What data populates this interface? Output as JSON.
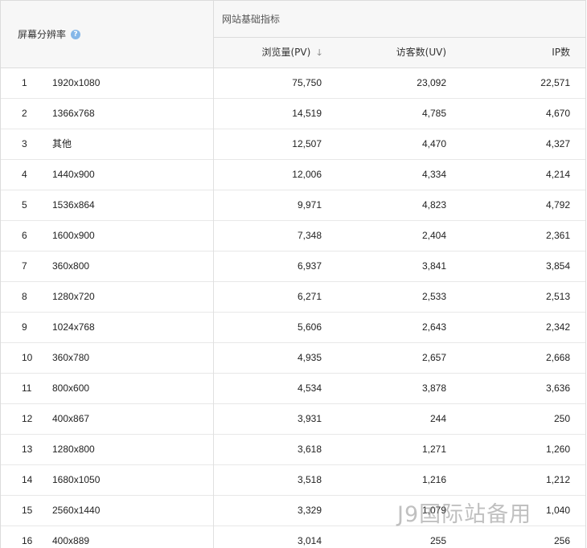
{
  "header": {
    "dimension_label": "屏幕分辨率",
    "help_icon": "?",
    "group_label": "网站基础指标",
    "columns": {
      "pv": "浏览量(PV)",
      "uv": "访客数(UV)",
      "ip": "IP数"
    },
    "sort_icon": "🡓"
  },
  "rows": [
    {
      "idx": "1",
      "res": "1920x1080",
      "pv": "75,750",
      "uv": "23,092",
      "ip": "22,571"
    },
    {
      "idx": "2",
      "res": "1366x768",
      "pv": "14,519",
      "uv": "4,785",
      "ip": "4,670"
    },
    {
      "idx": "3",
      "res": "其他",
      "pv": "12,507",
      "uv": "4,470",
      "ip": "4,327"
    },
    {
      "idx": "4",
      "res": "1440x900",
      "pv": "12,006",
      "uv": "4,334",
      "ip": "4,214"
    },
    {
      "idx": "5",
      "res": "1536x864",
      "pv": "9,971",
      "uv": "4,823",
      "ip": "4,792"
    },
    {
      "idx": "6",
      "res": "1600x900",
      "pv": "7,348",
      "uv": "2,404",
      "ip": "2,361"
    },
    {
      "idx": "7",
      "res": "360x800",
      "pv": "6,937",
      "uv": "3,841",
      "ip": "3,854"
    },
    {
      "idx": "8",
      "res": "1280x720",
      "pv": "6,271",
      "uv": "2,533",
      "ip": "2,513"
    },
    {
      "idx": "9",
      "res": "1024x768",
      "pv": "5,606",
      "uv": "2,643",
      "ip": "2,342"
    },
    {
      "idx": "10",
      "res": "360x780",
      "pv": "4,935",
      "uv": "2,657",
      "ip": "2,668"
    },
    {
      "idx": "11",
      "res": "800x600",
      "pv": "4,534",
      "uv": "3,878",
      "ip": "3,636"
    },
    {
      "idx": "12",
      "res": "400x867",
      "pv": "3,931",
      "uv": "244",
      "ip": "250"
    },
    {
      "idx": "13",
      "res": "1280x800",
      "pv": "3,618",
      "uv": "1,271",
      "ip": "1,260"
    },
    {
      "idx": "14",
      "res": "1680x1050",
      "pv": "3,518",
      "uv": "1,216",
      "ip": "1,212"
    },
    {
      "idx": "15",
      "res": "2560x1440",
      "pv": "3,329",
      "uv": "1,079",
      "ip": "1,040"
    },
    {
      "idx": "16",
      "res": "400x889",
      "pv": "3,014",
      "uv": "255",
      "ip": "256"
    }
  ],
  "watermark": "J9国际站备用"
}
